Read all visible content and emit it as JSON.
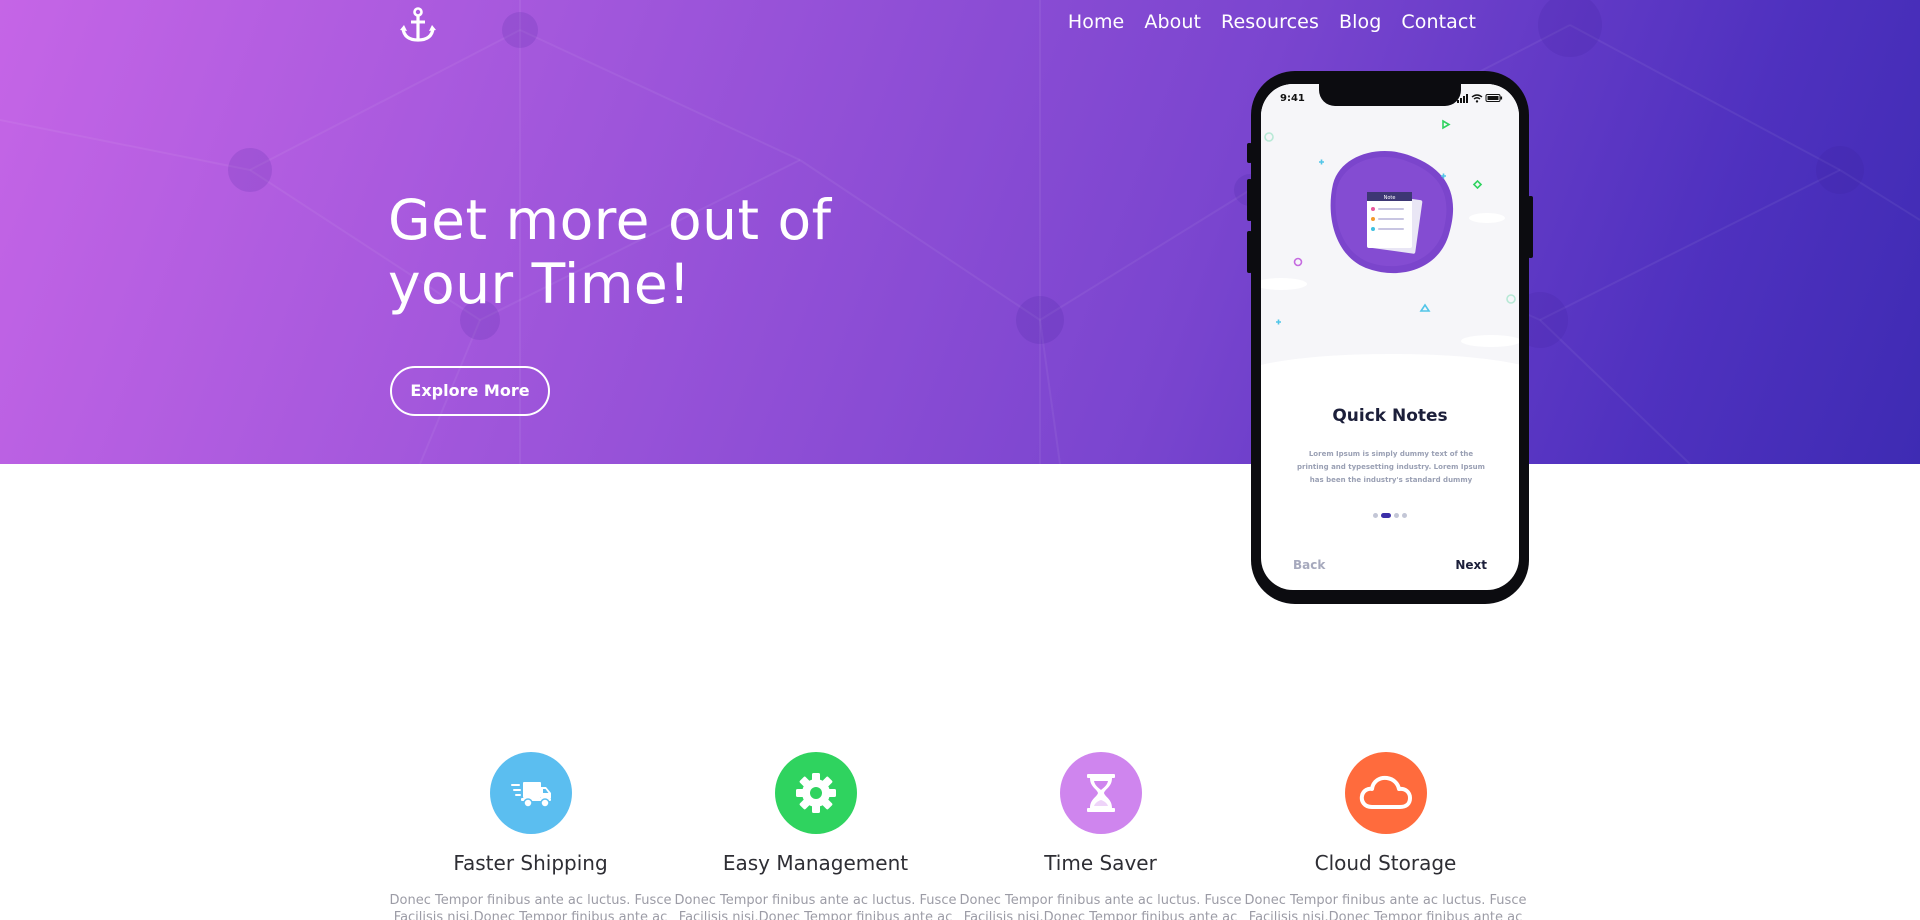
{
  "brand": {
    "logo_icon": "anchor-icon"
  },
  "nav": {
    "items": [
      {
        "label": "Home"
      },
      {
        "label": "About"
      },
      {
        "label": "Resources"
      },
      {
        "label": "Blog"
      },
      {
        "label": "Contact"
      }
    ]
  },
  "hero": {
    "headline_line1": "Get more out of",
    "headline_line2": "your Time!",
    "button_label": "Explore More",
    "gradient_colors": [
      "#c565e6",
      "#7a45cf",
      "#3e2bb3"
    ]
  },
  "phone": {
    "status_time": "9:41",
    "card_title": "Quick Notes",
    "card_description": "Lorem Ipsum is simply dummy text of the printing and typesetting industry. Lorem Ipsum has been the industry's standard dummy",
    "note_label": "Note",
    "back_label": "Back",
    "next_label": "Next",
    "pagination": {
      "total": 4,
      "active": 2
    }
  },
  "features": [
    {
      "icon": "truck-icon",
      "color": "#5bbef0",
      "title": "Faster Shipping",
      "line1": "Donec Tempor finibus ante ac luctus. Fusce",
      "line2": "Facilisis nisi.Donec Tempor finibus ante ac"
    },
    {
      "icon": "gear-icon",
      "color": "#2fd35f",
      "title": "Easy Management",
      "line1": "Donec Tempor finibus ante ac luctus. Fusce",
      "line2": "Facilisis nisi.Donec Tempor finibus ante ac"
    },
    {
      "icon": "hourglass-icon",
      "color": "#cf85ee",
      "title": "Time Saver",
      "line1": "Donec Tempor finibus ante ac luctus. Fusce",
      "line2": "Facilisis nisi.Donec Tempor finibus ante ac"
    },
    {
      "icon": "cloud-icon",
      "color": "#ff6b3d",
      "title": "Cloud Storage",
      "line1": "Donec Tempor finibus ante ac luctus. Fusce",
      "line2": "Facilisis nisi.Donec Tempor finibus ante ac"
    }
  ]
}
